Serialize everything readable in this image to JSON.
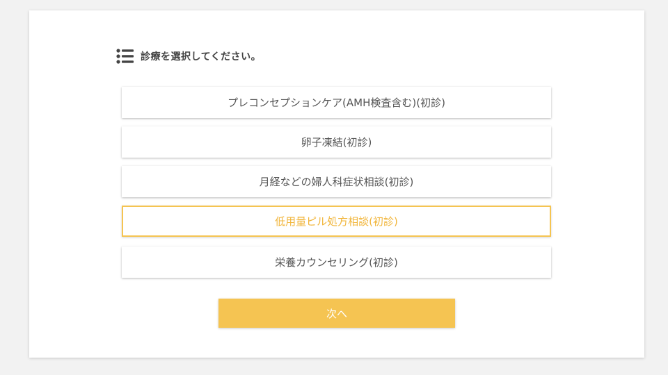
{
  "header": {
    "icon": "list-icon",
    "title": "診療を選択してください。"
  },
  "options": [
    {
      "label": "プレコンセプションケア(AMH検査含む)(初診)",
      "selected": false
    },
    {
      "label": "卵子凍結(初診)",
      "selected": false
    },
    {
      "label": "月経などの婦人科症状相談(初診)",
      "selected": false
    },
    {
      "label": "低用量ピル処方相談(初診)",
      "selected": true
    },
    {
      "label": "栄養カウンセリング(初診)",
      "selected": false
    }
  ],
  "next_button": {
    "label": "次へ"
  },
  "colors": {
    "accent": "#f5c452",
    "selected_border": "#f5c451",
    "selected_text": "#f1b53a",
    "text": "#555555",
    "heading_text": "#444444"
  }
}
